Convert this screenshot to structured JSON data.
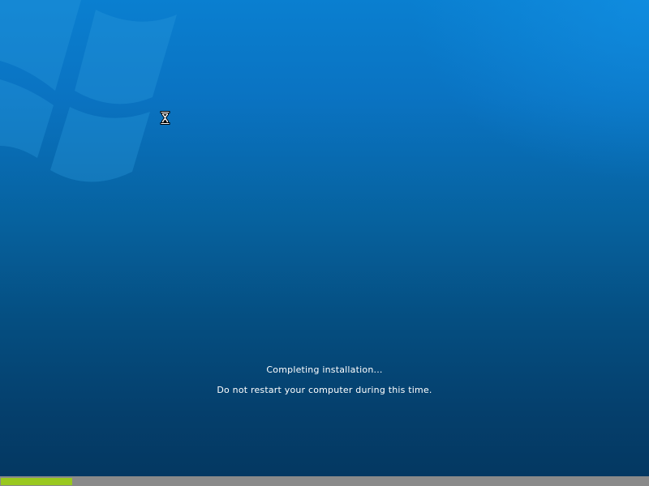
{
  "status": {
    "primary_message": "Completing installation...",
    "secondary_message": "Do not restart your computer during this time."
  },
  "progress": {
    "percent": 11,
    "fill_color": "#99c81f",
    "track_color": "#8a8a8a"
  },
  "cursor": {
    "icon": "hourglass-busy-icon"
  },
  "background": {
    "logo": "windows-flag-logo-watermark"
  },
  "colors": {
    "bg_top": "#0a7fd0",
    "bg_bottom": "#043760",
    "text": "#ffffff"
  }
}
